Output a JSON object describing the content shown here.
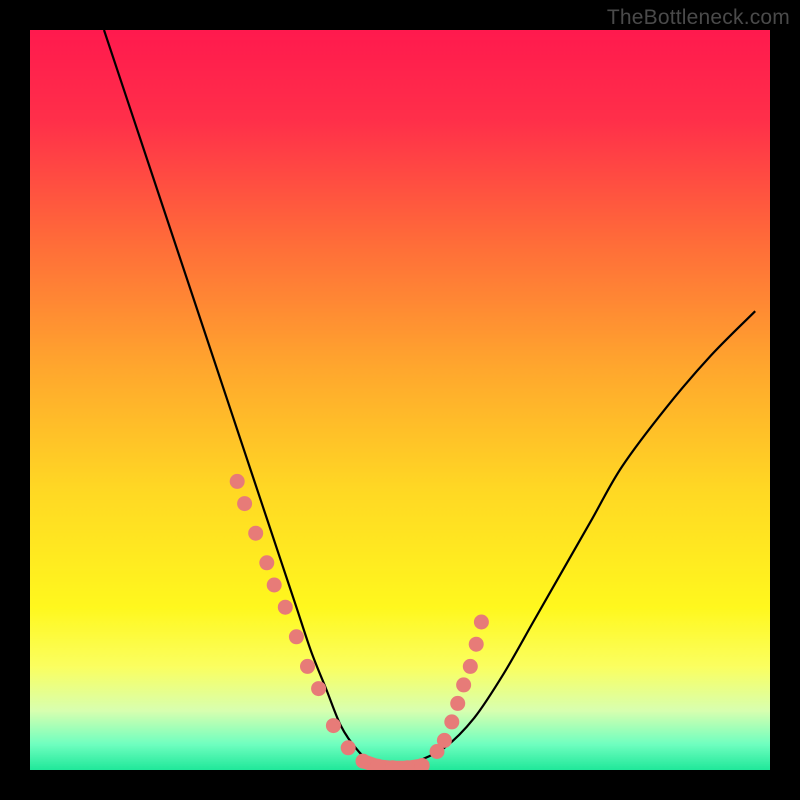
{
  "watermark": "TheBottleneck.com",
  "gradient": {
    "stops": [
      {
        "offset": 0.0,
        "color": "#ff1a4e"
      },
      {
        "offset": 0.12,
        "color": "#ff2f4a"
      },
      {
        "offset": 0.28,
        "color": "#ff6a3a"
      },
      {
        "offset": 0.45,
        "color": "#ffa52e"
      },
      {
        "offset": 0.62,
        "color": "#ffd824"
      },
      {
        "offset": 0.78,
        "color": "#fff81e"
      },
      {
        "offset": 0.86,
        "color": "#fbff60"
      },
      {
        "offset": 0.92,
        "color": "#d8ffb0"
      },
      {
        "offset": 0.965,
        "color": "#70ffc0"
      },
      {
        "offset": 1.0,
        "color": "#20e89a"
      }
    ]
  },
  "marker_color": "#e77b78",
  "chart_data": {
    "type": "line",
    "title": "",
    "xlabel": "",
    "ylabel": "",
    "xlim": [
      0,
      100
    ],
    "ylim": [
      0,
      100
    ],
    "series": [
      {
        "name": "bottleneck-curve",
        "x": [
          10,
          14,
          18,
          22,
          26,
          28,
          30,
          32,
          34,
          36,
          38,
          40,
          42,
          44,
          46,
          48,
          50,
          52,
          56,
          60,
          64,
          68,
          72,
          76,
          80,
          86,
          92,
          98
        ],
        "y": [
          100,
          88,
          76,
          64,
          52,
          46,
          40,
          34,
          28,
          22,
          16,
          11,
          6,
          3,
          1,
          0,
          0,
          1,
          3,
          7,
          13,
          20,
          27,
          34,
          41,
          49,
          56,
          62
        ]
      }
    ],
    "markers": {
      "name": "highlighted-points",
      "x": [
        28,
        29,
        30.5,
        32,
        33,
        34.5,
        36,
        37.5,
        39,
        41,
        43,
        45,
        47,
        49,
        51,
        53,
        55,
        56,
        57,
        57.8,
        58.6,
        59.5,
        60.3,
        61
      ],
      "y": [
        39,
        36,
        32,
        28,
        25,
        22,
        18,
        14,
        11,
        6,
        3,
        1.2,
        0.5,
        0.3,
        0.3,
        0.6,
        2.5,
        4,
        6.5,
        9,
        11.5,
        14,
        17,
        20
      ]
    }
  }
}
